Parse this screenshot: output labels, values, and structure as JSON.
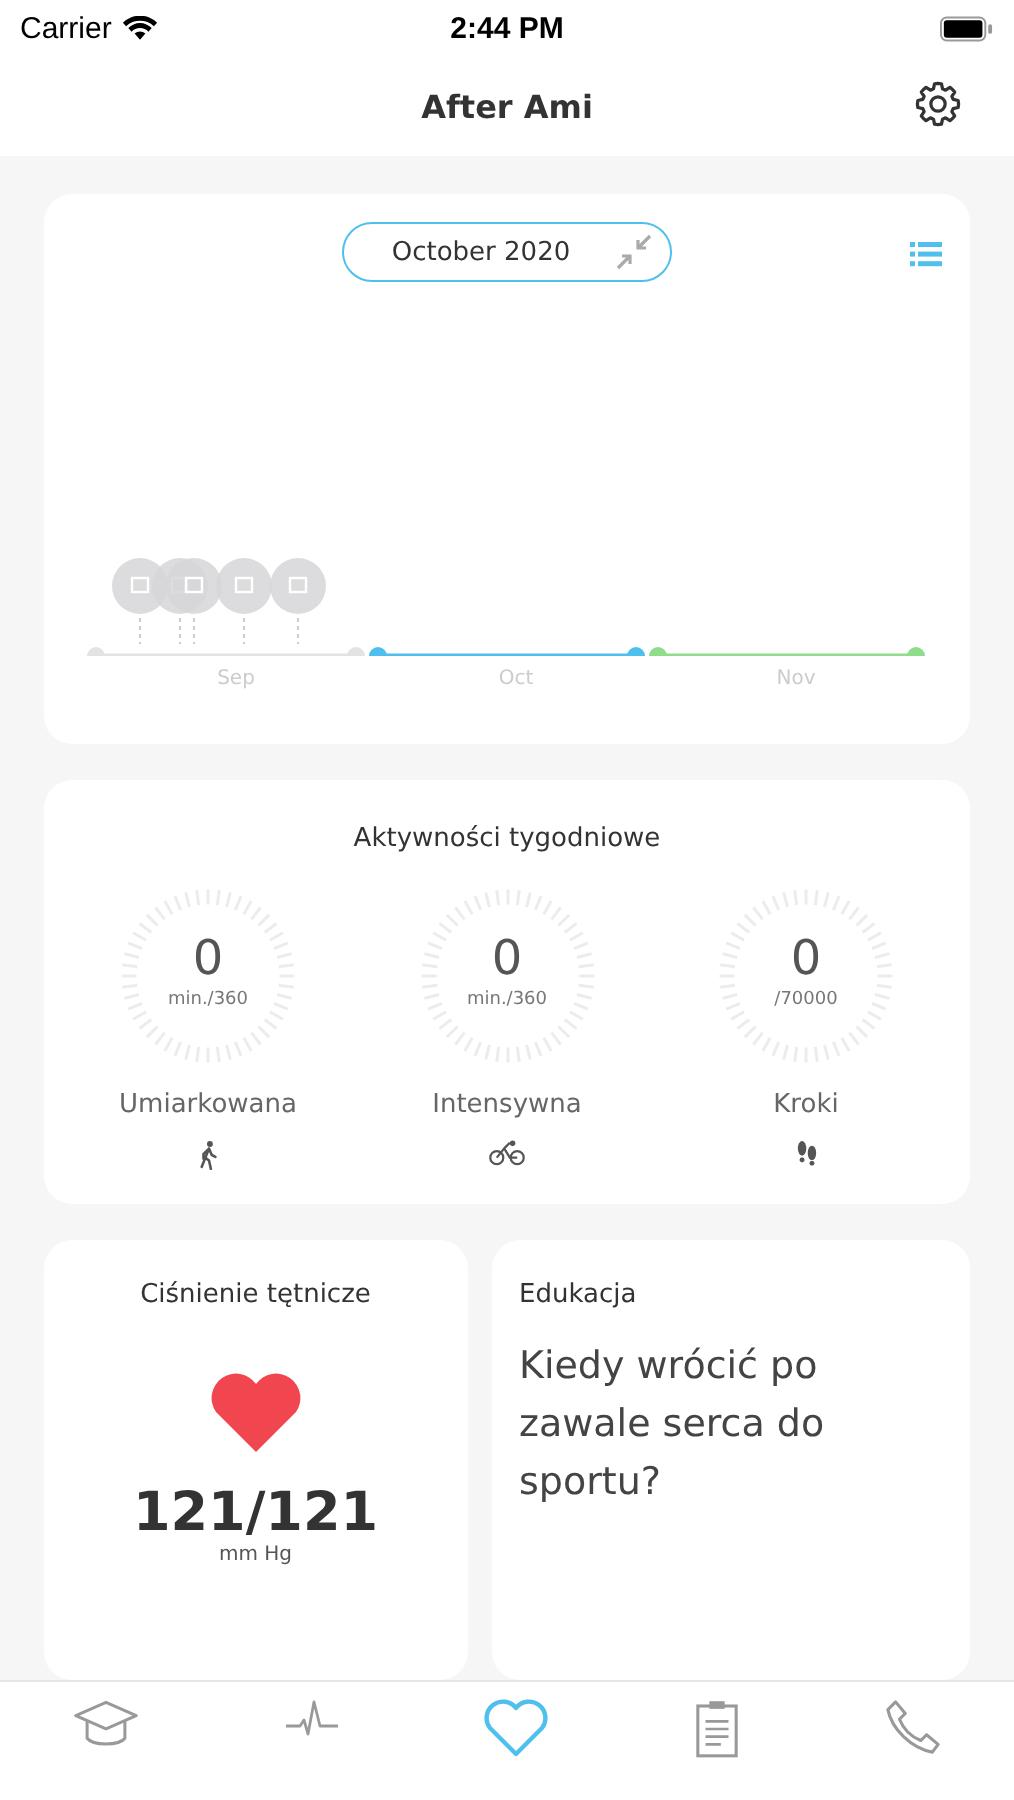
{
  "status_bar": {
    "carrier": "Carrier",
    "time": "2:44 PM"
  },
  "header": {
    "title": "After Ami"
  },
  "timeline": {
    "month_picker": "October 2020",
    "months": [
      {
        "label": "Sep",
        "color": "#e3e3e3"
      },
      {
        "label": "Oct",
        "color": "#4fc0ee"
      },
      {
        "label": "Nov",
        "color": "#8fdc8a"
      }
    ]
  },
  "weekly_activity": {
    "title": "Aktywności tygodniowe",
    "items": [
      {
        "value": "0",
        "target": "min./360",
        "label": "Umiarkowana"
      },
      {
        "value": "0",
        "target": "min./360",
        "label": "Intensywna"
      },
      {
        "value": "0",
        "target": "/70000",
        "label": "Kroki"
      }
    ]
  },
  "blood_pressure": {
    "title": "Ciśnienie tętnicze",
    "value": "121/121",
    "unit": "mm Hg"
  },
  "education": {
    "title": "Edukacja",
    "article": "Kiedy wrócić po zawale serca do sportu?"
  },
  "tab_bar": [
    {
      "selected": false
    },
    {
      "selected": false
    },
    {
      "selected": true
    },
    {
      "selected": false
    },
    {
      "selected": false
    }
  ]
}
